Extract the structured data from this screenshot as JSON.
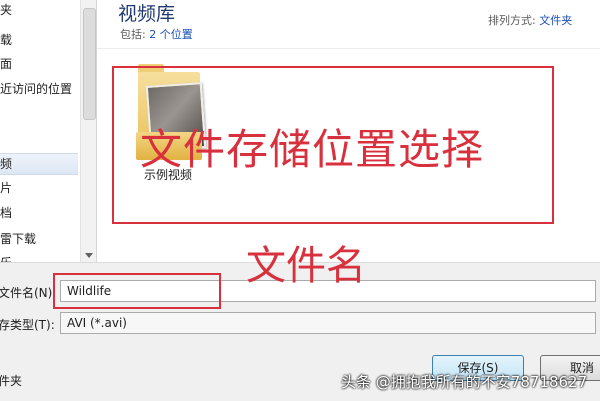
{
  "nav": {
    "items": [
      {
        "label": "夹"
      },
      {
        "label": "载"
      },
      {
        "label": "面"
      },
      {
        "label": "近访问的位置"
      },
      {
        "label": "频",
        "selected": true
      },
      {
        "label": "片"
      },
      {
        "label": "档"
      },
      {
        "label": "雷下载"
      },
      {
        "label": "乐"
      }
    ]
  },
  "library": {
    "title": "视频库",
    "includes_label": "包括:",
    "includes_link": "2 个位置",
    "arrange_label": "排列方式:",
    "arrange_value": "文件夹"
  },
  "files": [
    {
      "name": "示例视频",
      "icon": "folder-with-video-icon"
    }
  ],
  "annotations": {
    "storage_label": "文件存储位置选择",
    "filename_label": "文件名",
    "color": "#d8313d"
  },
  "form": {
    "filename_label": "文件名(N):",
    "filename_value": "Wildlife",
    "filetype_label": "存类型(T):",
    "filetype_value": "AVI (*.avi)",
    "hide_folders_label": "件夹"
  },
  "buttons": {
    "save": "保存(S)",
    "cancel": "取消"
  },
  "watermark": "头条 @拥抱我所有的不安78718627"
}
